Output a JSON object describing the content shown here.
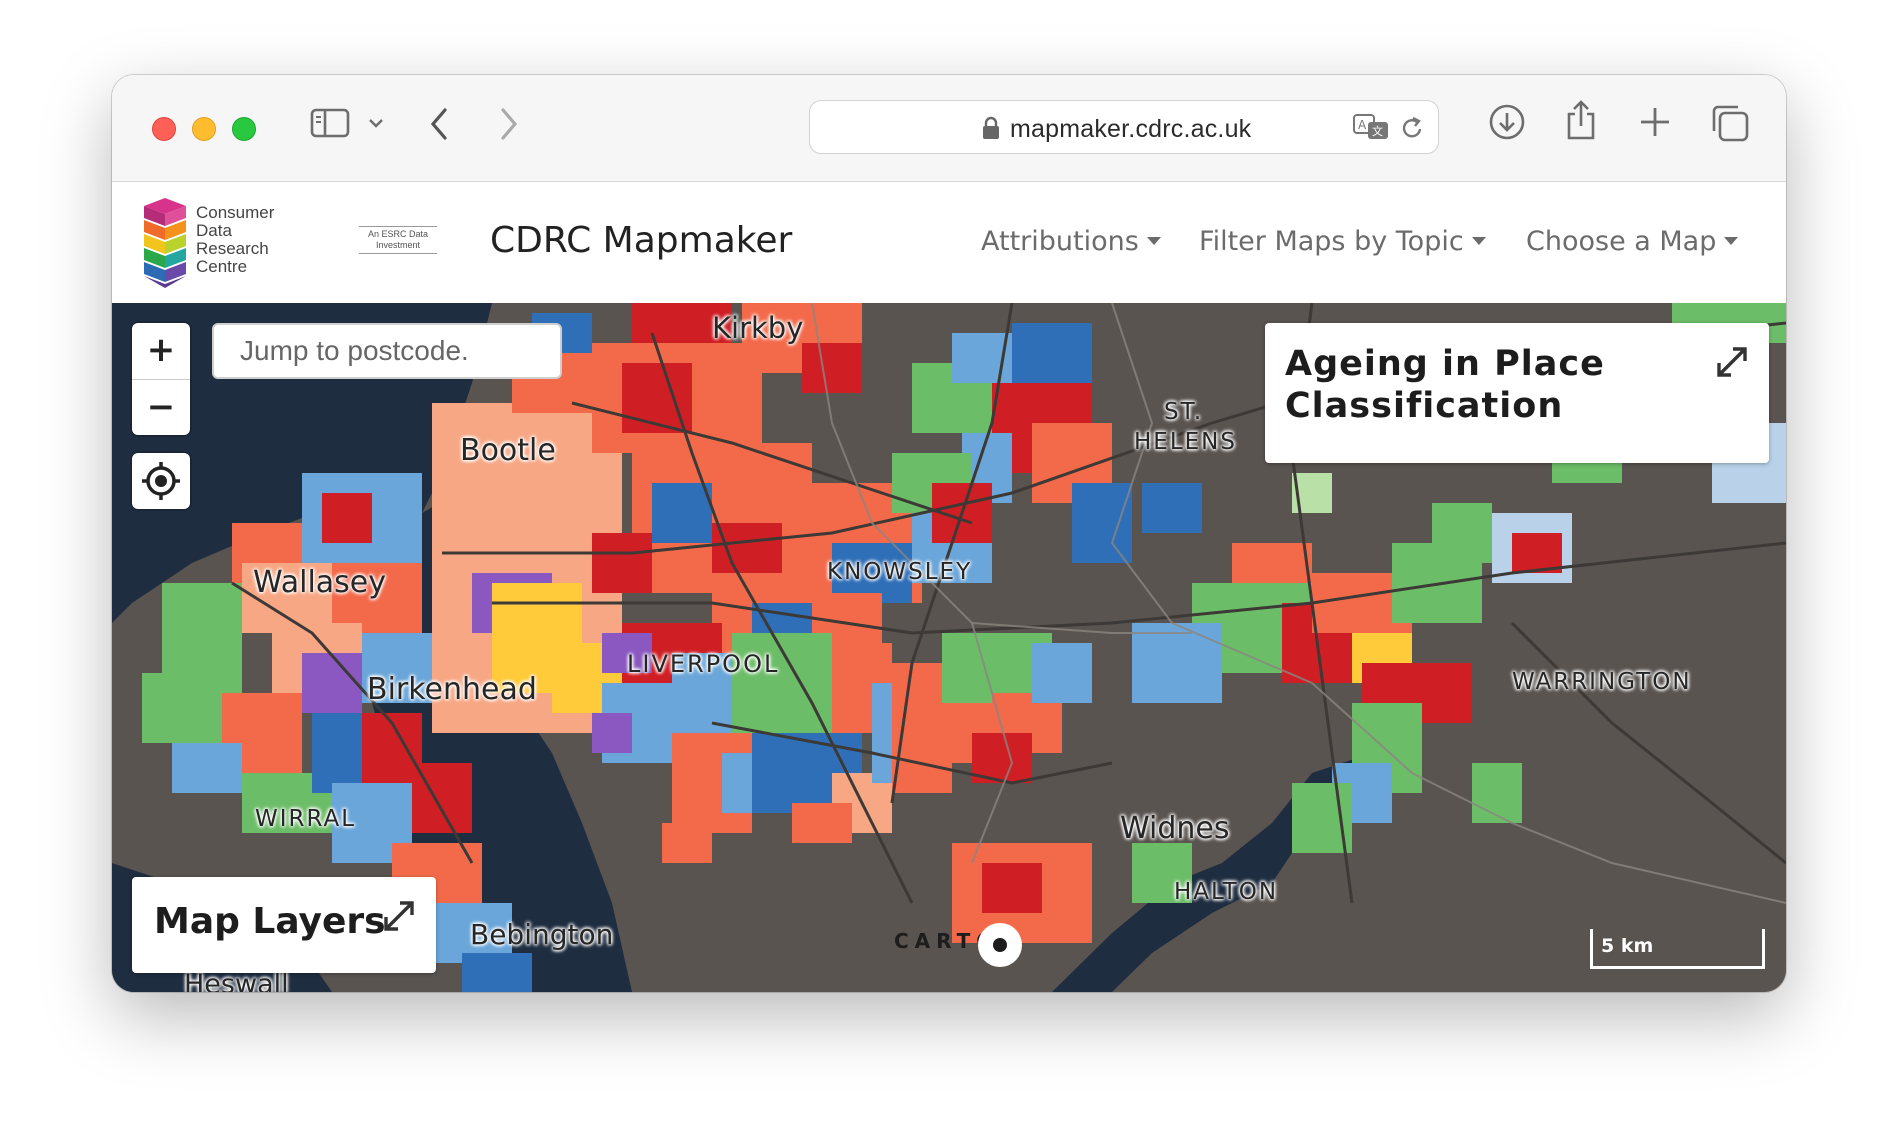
{
  "browser": {
    "url": "mapmaker.cdrc.ac.uk"
  },
  "header": {
    "logo_lines": [
      "Consumer",
      "Data",
      "Research",
      "Centre"
    ],
    "esrc_lines": [
      "An ESRC Data",
      "Investment"
    ],
    "app_title": "CDRC Mapmaker",
    "nav": {
      "attributions": "Attributions",
      "filter_topic": "Filter Maps by Topic",
      "choose_map": "Choose a Map"
    }
  },
  "map": {
    "zoom_in": "+",
    "zoom_out": "−",
    "postcode_placeholder": "Jump to postcode.",
    "legend_title": "Ageing in Place Classification",
    "layers_title": "Map Layers",
    "scale_label": "5 km",
    "attribution": "CARTO",
    "place_labels": {
      "kirkby": "Kirkby",
      "bootle": "Bootle",
      "st_helens_1": "ST.",
      "st_helens_2": "HELENS",
      "knowsley": "KNOWSLEY",
      "wallasey": "Wallasey",
      "liverpool": "LIVERPOOL",
      "birkenhead": "Birkenhead",
      "warrington": "WARRINGTON",
      "wirral": "WIRRAL",
      "widnes": "Widnes",
      "halton": "HALTON",
      "bebington": "Bebington",
      "heswall": "Heswall"
    },
    "colors": {
      "land": "#5a5450",
      "water": "#1f2d40",
      "red": "#cf1f25",
      "orange_red": "#f36a4b",
      "salmon": "#f7a784",
      "dark_blue": "#2f6fb8",
      "light_blue": "#6aa6d9",
      "pale_blue": "#b9d2ea",
      "green": "#6cbd68",
      "pale_green": "#b8e0a7",
      "purple": "#8a58c0",
      "yellow": "#ffcb3a"
    }
  }
}
